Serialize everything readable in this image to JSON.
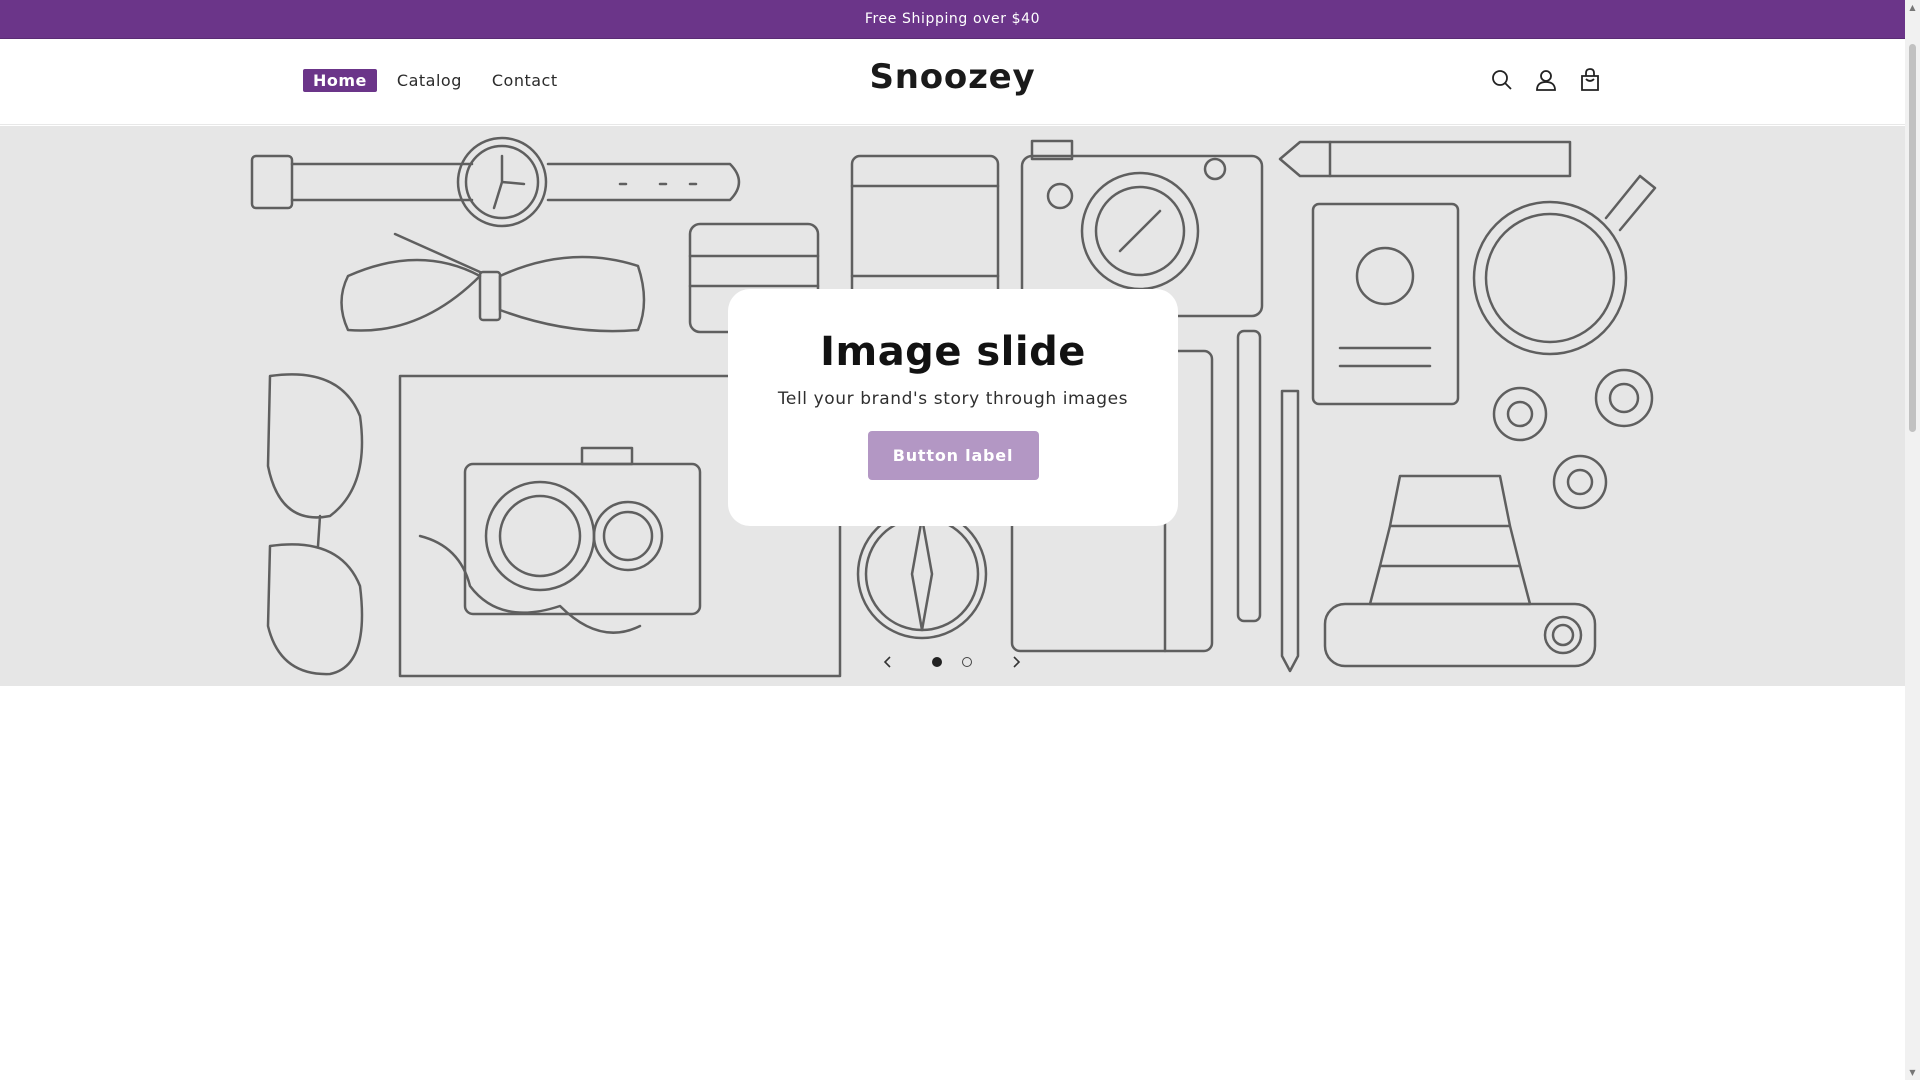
{
  "announcement": {
    "text": "Free Shipping over $40"
  },
  "header": {
    "brand": "Snoozey",
    "nav": [
      {
        "label": "Home",
        "active": true
      },
      {
        "label": "Catalog",
        "active": false
      },
      {
        "label": "Contact",
        "active": false
      }
    ],
    "icons": [
      "search-icon",
      "account-icon",
      "cart-icon"
    ]
  },
  "slideshow": {
    "heading": "Image slide",
    "text": "Tell your brand's story through images",
    "button_label": "Button label",
    "total_slides": 2,
    "active_slide": 1
  },
  "colors": {
    "accent": "#6b3589",
    "button": "#b397c4",
    "hero_bg": "#e6e6e6"
  }
}
